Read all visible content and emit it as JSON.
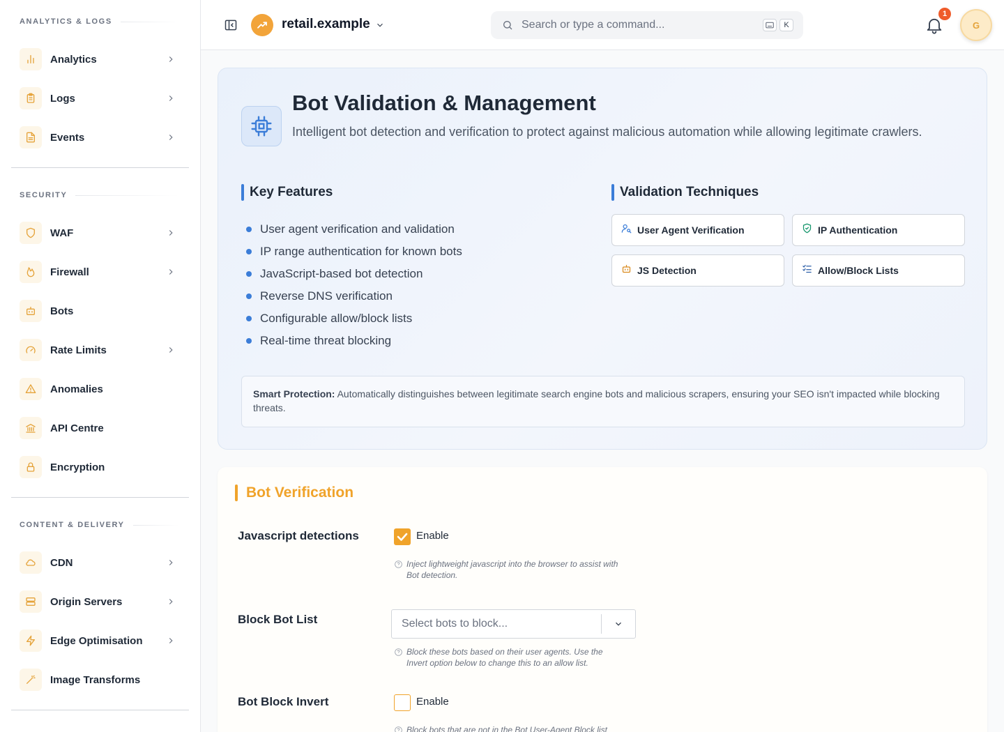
{
  "sidebar": {
    "sections": [
      {
        "title": "ANALYTICS & LOGS",
        "items": [
          {
            "label": "Analytics",
            "icon": "bar-chart-icon",
            "has_submenu": true
          },
          {
            "label": "Logs",
            "icon": "clipboard-icon",
            "has_submenu": true
          },
          {
            "label": "Events",
            "icon": "file-text-icon",
            "has_submenu": true
          }
        ]
      },
      {
        "title": "SECURITY",
        "items": [
          {
            "label": "WAF",
            "icon": "shield-icon",
            "has_submenu": true
          },
          {
            "label": "Firewall",
            "icon": "flame-icon",
            "has_submenu": true
          },
          {
            "label": "Bots",
            "icon": "bot-icon",
            "has_submenu": false
          },
          {
            "label": "Rate Limits",
            "icon": "gauge-icon",
            "has_submenu": true
          },
          {
            "label": "Anomalies",
            "icon": "warning-triangle-icon",
            "has_submenu": false
          },
          {
            "label": "API Centre",
            "icon": "landmark-icon",
            "has_submenu": false
          },
          {
            "label": "Encryption",
            "icon": "lock-icon",
            "has_submenu": false
          }
        ]
      },
      {
        "title": "CONTENT & DELIVERY",
        "items": [
          {
            "label": "CDN",
            "icon": "cloud-icon",
            "has_submenu": true
          },
          {
            "label": "Origin Servers",
            "icon": "server-icon",
            "has_submenu": true
          },
          {
            "label": "Edge Optimisation",
            "icon": "lightning-icon",
            "has_submenu": true
          },
          {
            "label": "Image Transforms",
            "icon": "magic-wand-icon",
            "has_submenu": false
          }
        ]
      }
    ]
  },
  "topbar": {
    "site_name": "retail.example",
    "search_placeholder": "Search or type a command...",
    "search_shortcut_key": "K",
    "notification_count": "1",
    "avatar_initial": "G"
  },
  "hero": {
    "title": "Bot Validation & Management",
    "description": "Intelligent bot detection and verification to protect against malicious automation while allowing legitimate crawlers.",
    "features_heading": "Key Features",
    "features": [
      "User agent verification and validation",
      "IP range authentication for known bots",
      "JavaScript-based bot detection",
      "Reverse DNS verification",
      "Configurable allow/block lists",
      "Real-time threat blocking"
    ],
    "techniques_heading": "Validation Techniques",
    "techniques": [
      {
        "label": "User Agent Verification",
        "icon": "user-search-icon",
        "color": "#3b7dd8"
      },
      {
        "label": "IP Authentication",
        "icon": "shield-check-icon",
        "color": "#14956b"
      },
      {
        "label": "JS Detection",
        "icon": "bot-icon",
        "color": "#d98a1c"
      },
      {
        "label": "Allow/Block Lists",
        "icon": "list-checks-icon",
        "color": "#2d5fa8"
      }
    ],
    "note_label": "Smart Protection:",
    "note_text": " Automatically distinguishes between legitimate search engine bots and malicious scrapers, ensuring your SEO isn't impacted while blocking threats."
  },
  "bot_verification": {
    "title": "Bot Verification",
    "js_detection": {
      "label": "Javascript detections",
      "checkbox_label": "Enable",
      "checked": true,
      "help": "Inject lightweight javascript into the browser to assist with Bot detection."
    },
    "block_bot_list": {
      "label": "Block Bot List",
      "placeholder": "Select bots to block...",
      "help": "Block these bots based on their user agents. Use the Invert option below to change this to an allow list."
    },
    "bot_block_invert": {
      "label": "Bot Block Invert",
      "checkbox_label": "Enable",
      "checked": false,
      "help": "Block bots that are not in the Bot User-Agent Block list"
    }
  },
  "colors": {
    "accent": "#f0a32a",
    "info": "#3b7dd8",
    "badge": "#ef5b2a"
  }
}
